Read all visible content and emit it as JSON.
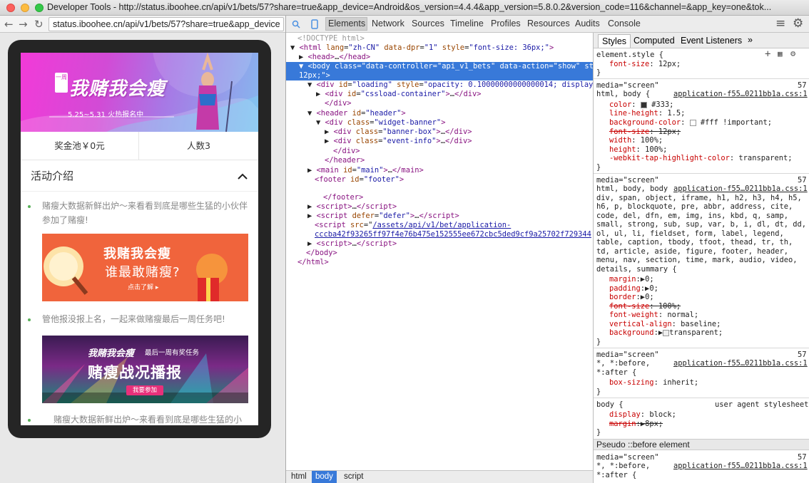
{
  "window": {
    "title": "Developer Tools - http://status.iboohee.cn/api/v1/bets/57?share=true&app_device=Android&os_version=4.4.4&app_version=5.8.0.2&version_code=116&channel=&app_key=one&tok..."
  },
  "browser": {
    "url": "status.iboohee.cn/api/v1/bets/57?share=true&app_device"
  },
  "page": {
    "banner_tag": "一周",
    "banner_title": "我赌我会瘦",
    "banner_date": "5.25~5.31 火热报名中",
    "stat_pool": "奖金池￥0元",
    "stat_count": "人数3",
    "intro_title": "活动介绍",
    "items": [
      "赌瘦大数据新鲜出炉～来看看到底是哪些生猛的小伙伴参加了赌瘦!",
      "管他报没报上名，一起来做赌瘦最后一周任务吧!",
      "赌瘦大数据新鲜出炉～来看看到底是哪些生猛的小"
    ],
    "promo1": {
      "title": "我赌我会瘦",
      "subtitle": "谁最敢赌瘦?",
      "cta": "点击了解"
    },
    "promo2": {
      "title": "我赌我会瘦",
      "tag": "最后一周有奖任务",
      "big": "赌瘦战况播报",
      "cta": "我要参加"
    }
  },
  "devtools": {
    "tabs": [
      "Elements",
      "Network",
      "Sources",
      "Timeline",
      "Profiles",
      "Resources",
      "Audits",
      "Console"
    ],
    "breadcrumbs": [
      "html",
      "body",
      "script"
    ],
    "style_tabs": [
      "Styles",
      "Computed",
      "Event Listeners",
      "»"
    ],
    "dom": {
      "doctype": "<!DOCTYPE html>",
      "html_lang": "\"zh-CN\"",
      "html_dpr": "\"1\"",
      "html_style": "\"font-size: 36px;\"",
      "body_controller": "\"api_v1_bets\"",
      "body_action": "\"show\"",
      "body_style_tail": "12px;\">",
      "loading_style": "\"opacity: 0.10000000000000014; display",
      "script_src": "/assets/api/v1/bet/application-",
      "script_src2": "cccba42f93265ff97f4e76b475e152555ee672cbc5ded9cf9a25702f729344"
    },
    "styles": {
      "element_style_prop": "font-size",
      "element_style_val": "12px;",
      "rule1_media": "media=\"screen\"",
      "rule1_line": "57",
      "rule1_selector": "html, body {",
      "rule1_source": "application-f55…0211bb1a.css:1",
      "rule1_props": [
        {
          "name": "color",
          "value": "#333;"
        },
        {
          "name": "line-height",
          "value": "1.5;"
        },
        {
          "name": "background-color",
          "value": "#fff !important;"
        },
        {
          "name": "font-size",
          "value": "12px;"
        },
        {
          "name": "width",
          "value": "100%;"
        },
        {
          "name": "height",
          "value": "100%;"
        },
        {
          "name": "-webkit-tap-highlight-color",
          "value": "transparent;"
        }
      ],
      "rule2_selector_lines": [
        "html, body, body",
        "div, span, object, iframe, h1, h2, h3, h4, h5,",
        "h6, p, blockquote, pre, abbr, address, cite,",
        "code, del, dfn, em, img, ins, kbd, q, samp,",
        "small, strong, sub, sup, var, b, i, dl, dt, dd,",
        "ol, ul, li, fieldset, form, label, legend,",
        "table, caption, tbody, tfoot, thead, tr, th,",
        "td, article, aside, figure, footer, header,",
        "menu, nav, section, time, mark, audio, video,",
        "details, summary {"
      ],
      "rule2_props": [
        {
          "name": "margin",
          "value": "0;"
        },
        {
          "name": "padding",
          "value": "0;"
        },
        {
          "name": "border",
          "value": "0;"
        },
        {
          "name": "font-size",
          "value": "100%;"
        },
        {
          "name": "font-weight",
          "value": "normal;"
        },
        {
          "name": "vertical-align",
          "value": "baseline;"
        },
        {
          "name": "background",
          "value": "transparent;"
        }
      ],
      "rule3_selector1": "*, *:before,",
      "rule3_selector2": "*:after {",
      "rule3_prop": "box-sizing",
      "rule3_val": "inherit;",
      "ua_selector": "body {",
      "ua_label": "user agent stylesheet",
      "ua_props": [
        {
          "name": "display",
          "value": "block;"
        },
        {
          "name": "margin",
          "value": "8px;"
        }
      ],
      "pseudo_header": "Pseudo ::before element"
    }
  }
}
